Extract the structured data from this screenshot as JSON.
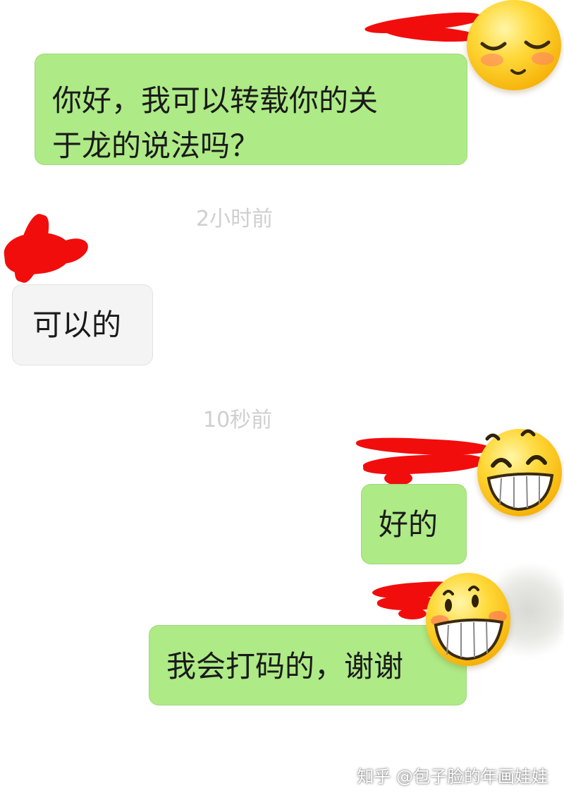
{
  "messages": [
    {
      "side": "sent",
      "text_line1": "你好，我可以转载你的关",
      "text_line2": "于龙的说法吗？"
    },
    {
      "side": "received",
      "text": "可以的"
    },
    {
      "side": "sent",
      "text": "好的"
    },
    {
      "side": "sent",
      "text": "我会打码的，谢谢"
    }
  ],
  "timestamps": [
    "2小时前",
    "10秒前"
  ],
  "watermark": "知乎 @包子脸的年画娃娃",
  "colors": {
    "sent_bubble": "#aeea86",
    "received_bubble": "#f4f4f4",
    "redaction": "#f20d0d",
    "timestamp_text": "#cfcfcf"
  },
  "icons": [
    "blush-emoji-icon",
    "grin-emoji-icon",
    "grin-emoji-icon",
    "blurred-avatar"
  ]
}
